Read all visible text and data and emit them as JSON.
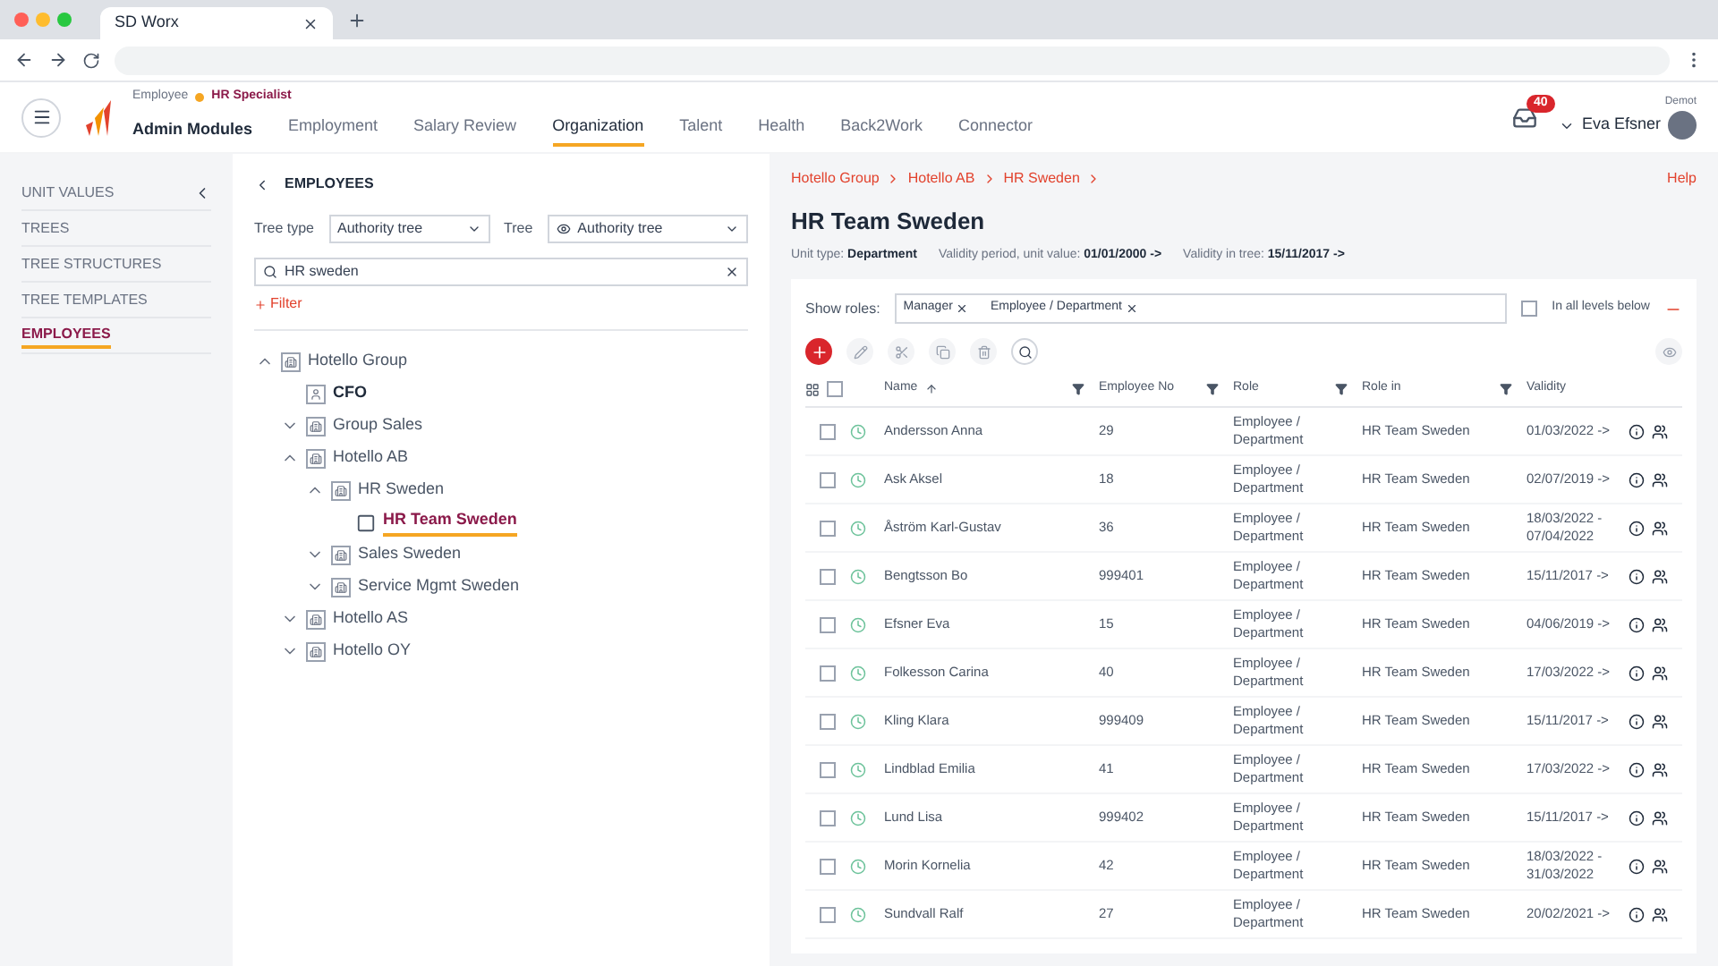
{
  "browser": {
    "tab_title": "SD Worx"
  },
  "header": {
    "role_label": "Employee",
    "role": "HR Specialist",
    "modules": "Admin Modules",
    "nav": [
      {
        "label": "Employment",
        "selected": false
      },
      {
        "label": "Salary Review",
        "selected": false
      },
      {
        "label": "Organization",
        "selected": true
      },
      {
        "label": "Talent",
        "selected": false
      },
      {
        "label": "Health",
        "selected": false
      },
      {
        "label": "Back2Work",
        "selected": false
      },
      {
        "label": "Connector",
        "selected": false
      }
    ],
    "notifications": "40",
    "context": "Demot",
    "user": "Eva Efsner",
    "help": "Help"
  },
  "sidebar": {
    "items": [
      {
        "label": "UNIT VALUES",
        "selected": false
      },
      {
        "label": "TREES",
        "selected": false
      },
      {
        "label": "TREE STRUCTURES",
        "selected": false
      },
      {
        "label": "TREE TEMPLATES",
        "selected": false
      },
      {
        "label": "EMPLOYEES",
        "selected": true
      }
    ]
  },
  "tree_panel": {
    "title": "EMPLOYEES",
    "tree_type_label": "Tree type",
    "tree_type": "Authority tree",
    "tree_label": "Tree",
    "tree": "Authority tree",
    "search": "HR sweden",
    "filter": "Filter",
    "nodes": [
      {
        "label": "Hotello Group",
        "kind": "unit",
        "expanded": true,
        "selected": false,
        "children": [
          {
            "label": "CFO",
            "kind": "position",
            "selected": false
          },
          {
            "label": "Group Sales",
            "kind": "unit",
            "expanded": false,
            "selected": false
          },
          {
            "label": "Hotello AB",
            "kind": "unit",
            "expanded": true,
            "selected": false,
            "children": [
              {
                "label": "HR Sweden",
                "kind": "unit",
                "expanded": true,
                "selected": false,
                "children": [
                  {
                    "label": "HR Team Sweden",
                    "kind": "leaf",
                    "selected": true
                  }
                ]
              },
              {
                "label": "Sales Sweden",
                "kind": "unit",
                "expanded": false,
                "selected": false
              },
              {
                "label": "Service Mgmt Sweden",
                "kind": "unit",
                "expanded": false,
                "selected": false
              }
            ]
          },
          {
            "label": "Hotello AS",
            "kind": "unit",
            "expanded": false,
            "selected": false
          },
          {
            "label": "Hotello OY",
            "kind": "unit",
            "expanded": false,
            "selected": false
          }
        ]
      }
    ]
  },
  "detail": {
    "breadcrumb": [
      "Hotello Group",
      "Hotello AB",
      "HR Sweden"
    ],
    "title": "HR Team Sweden",
    "info": [
      {
        "label": "Unit type:",
        "value": "Department"
      },
      {
        "label": "Validity period, unit value:",
        "value": "01/01/2000 ->"
      },
      {
        "label": "Validity in tree:",
        "value": "15/11/2017 ->"
      }
    ],
    "roles_label": "Show roles:",
    "roles": [
      "Manager",
      "Employee / Department"
    ],
    "all_levels": {
      "label": "In all levels below",
      "checked": false
    },
    "table": {
      "select_all": false,
      "columns": [
        "Name",
        "Employee No",
        "Role",
        "Role in",
        "Validity"
      ],
      "rows": [
        {
          "name": "Andersson Anna",
          "no": "29",
          "role": "Employee / Department",
          "role_in": "HR Team Sweden",
          "validity": "01/03/2022 ->",
          "selected": false
        },
        {
          "name": "Ask Aksel",
          "no": "18",
          "role": "Employee / Department",
          "role_in": "HR Team Sweden",
          "validity": "02/07/2019 ->",
          "selected": false
        },
        {
          "name": "Åström Karl-Gustav",
          "no": "36",
          "role": "Employee / Department",
          "role_in": "HR Team Sweden",
          "validity": "18/03/2022 - 07/04/2022",
          "selected": false
        },
        {
          "name": "Bengtsson Bo",
          "no": "999401",
          "role": "Employee / Department",
          "role_in": "HR Team Sweden",
          "validity": "15/11/2017 ->",
          "selected": false
        },
        {
          "name": "Efsner Eva",
          "no": "15",
          "role": "Employee / Department",
          "role_in": "HR Team Sweden",
          "validity": "04/06/2019 ->",
          "selected": false
        },
        {
          "name": "Folkesson Carina",
          "no": "40",
          "role": "Employee / Department",
          "role_in": "HR Team Sweden",
          "validity": "17/03/2022 ->",
          "selected": false
        },
        {
          "name": "Kling Klara",
          "no": "999409",
          "role": "Employee / Department",
          "role_in": "HR Team Sweden",
          "validity": "15/11/2017 ->",
          "selected": false
        },
        {
          "name": "Lindblad Emilia",
          "no": "41",
          "role": "Employee / Department",
          "role_in": "HR Team Sweden",
          "validity": "17/03/2022 ->",
          "selected": false
        },
        {
          "name": "Lund Lisa",
          "no": "999402",
          "role": "Employee / Department",
          "role_in": "HR Team Sweden",
          "validity": "15/11/2017 ->",
          "selected": false
        },
        {
          "name": "Morin Kornelia",
          "no": "42",
          "role": "Employee / Department",
          "role_in": "HR Team Sweden",
          "validity": "18/03/2022 - 31/03/2022",
          "selected": false
        },
        {
          "name": "Sundvall Ralf",
          "no": "27",
          "role": "Employee / Department",
          "role_in": "HR Team Sweden",
          "validity": "20/02/2021 ->",
          "selected": false
        }
      ]
    }
  }
}
